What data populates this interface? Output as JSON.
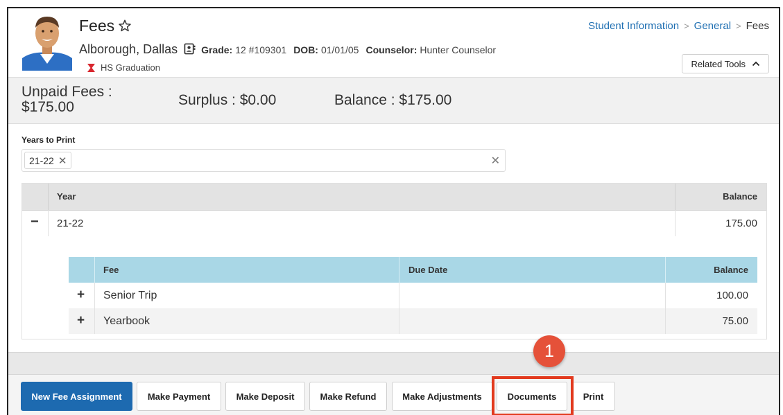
{
  "header": {
    "title": "Fees",
    "breadcrumb": [
      "Student Information",
      "General",
      "Fees"
    ],
    "student": {
      "name": "Alborough, Dallas",
      "grade_label": "Grade:",
      "grade_value": "12 #109301",
      "dob_label": "DOB:",
      "dob_value": "01/01/05",
      "counselor_label": "Counselor:",
      "counselor_value": "Hunter Counselor",
      "flag": "HS Graduation"
    },
    "related_tools_label": "Related Tools"
  },
  "summary": {
    "unpaid_label": "Unpaid Fees :",
    "unpaid_value": "$175.00",
    "surplus": "Surplus : $0.00",
    "balance": "Balance : $175.00"
  },
  "years_to_print": {
    "label": "Years to Print",
    "chips": [
      "21-22"
    ]
  },
  "fees_table": {
    "columns": [
      "Year",
      "Balance"
    ],
    "rows": [
      {
        "year": "21-22",
        "balance": "175.00",
        "detail_columns": [
          "Fee",
          "Due Date",
          "Balance"
        ],
        "details": [
          {
            "fee": "Senior Trip",
            "due_date": "",
            "balance": "100.00"
          },
          {
            "fee": "Yearbook",
            "due_date": "",
            "balance": "75.00"
          }
        ]
      }
    ]
  },
  "actions": {
    "new_fee_assignment": "New Fee Assignment",
    "make_payment": "Make Payment",
    "make_deposit": "Make Deposit",
    "make_refund": "Make Refund",
    "make_adjustments": "Make Adjustments",
    "documents": "Documents",
    "print": "Print"
  },
  "callout": {
    "number": "1"
  },
  "colors": {
    "primary": "#1d6ab0",
    "link": "#1f6fb2",
    "detail_header": "#a9d7e6",
    "highlight": "#e23a1e",
    "callout": "#e55139"
  }
}
